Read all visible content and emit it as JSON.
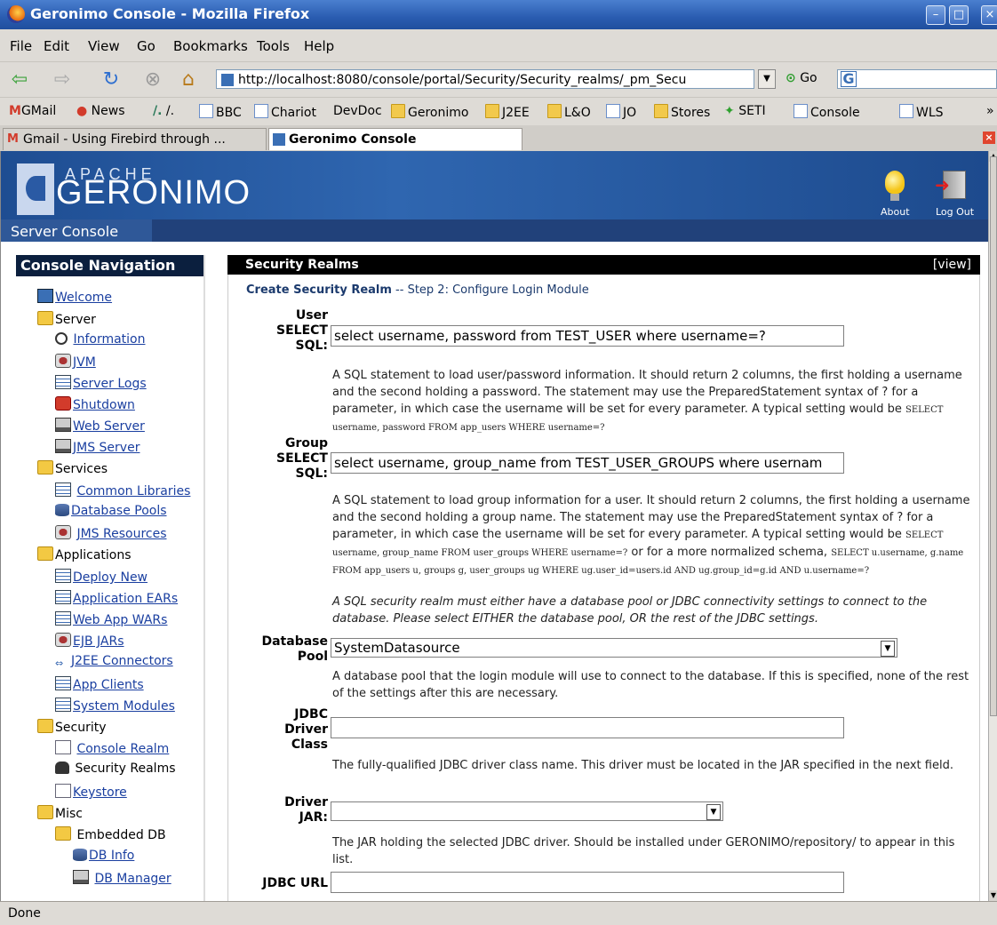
{
  "window": {
    "title": "Geronimo Console - Mozilla Firefox"
  },
  "menu": [
    "File",
    "Edit",
    "View",
    "Go",
    "Bookmarks",
    "Tools",
    "Help"
  ],
  "navbar": {
    "url": "http://localhost:8080/console/portal/Security/Security_realms/_pm_Secu",
    "go": "Go"
  },
  "bookmarks": [
    "GMail",
    "News",
    "/.",
    "BBC",
    "Chariot",
    "DevDoc",
    "Geronimo",
    "J2EE",
    "L&O",
    "JO",
    "Stores",
    "SETI",
    "Console",
    "WLS"
  ],
  "tabs": [
    "Gmail - Using Firebird through ...",
    "Geronimo Console"
  ],
  "header": {
    "apache": "APACHE",
    "geronimo": "GERONIMO",
    "server_console": "Server Console",
    "about": "About",
    "logout": "Log Out"
  },
  "nav": {
    "title": "Console Navigation",
    "welcome": "Welcome",
    "server": "Server",
    "information": "Information",
    "jvm": "JVM",
    "server_logs": "Server Logs",
    "shutdown": "Shutdown",
    "web_server": "Web Server",
    "jms_server": "JMS Server",
    "services": "Services",
    "common_libraries": "Common Libraries",
    "database_pools": "Database Pools",
    "jms_resources": "JMS Resources",
    "applications": "Applications",
    "deploy_new": "Deploy New",
    "application_ears": "Application EARs",
    "web_app_wars": "Web App WARs",
    "ejb_jars": "EJB JARs",
    "j2ee_connectors": "J2EE Connectors",
    "app_clients": "App Clients",
    "system_modules": "System Modules",
    "security": "Security",
    "console_realm": "Console Realm",
    "security_realms": "Security Realms",
    "keystore": "Keystore",
    "misc": "Misc",
    "embedded_db": "Embedded DB",
    "db_info": "DB Info",
    "db_manager": "DB Manager"
  },
  "main": {
    "title": "Security Realms",
    "view": "[view]",
    "step_bold": "Create Security Realm",
    "step_rest": " -- Step 2: Configure Login Module",
    "user_select": {
      "label1": "User",
      "label2": "SELECT",
      "label3": "SQL:",
      "value": "select username, password from TEST_USER where username=?",
      "desc": "A SQL statement to load user/password information. It should return 2 columns, the first holding a username and the second holding a password. The statement may use the PreparedStatement syntax of ? for a parameter, in which case the username will be set for every parameter. A typical setting would be ",
      "desc_code": "SELECT username, password FROM app_users WHERE username=?"
    },
    "group_select": {
      "label1": "Group",
      "label2": "SELECT",
      "label3": "SQL:",
      "value": "select username, group_name from TEST_USER_GROUPS where usernam",
      "desc": "A SQL statement to load group information for a user. It should return 2 columns, the first holding a username and the second holding a group name. The statement may use the PreparedStatement syntax of ? for a parameter, in which case the username will be set for every parameter. A typical setting would be ",
      "desc_code1": "SELECT username, group_name FROM user_groups WHERE username=?",
      "desc_mid": " or for a more normalized schema, ",
      "desc_code2": "SELECT u.username, g.name FROM app_users u, groups g, user_groups ug WHERE ug.user_id=users.id AND ug.group_id=g.id AND u.username=?"
    },
    "note": "A SQL security realm must either have a database pool or JDBC connectivity settings to connect to the database. Please select EITHER the database pool, OR the rest of the JDBC settings.",
    "db_pool": {
      "label1": "Database",
      "label2": "Pool",
      "value": "SystemDatasource",
      "desc": "A database pool that the login module will use to connect to the database. If this is specified, none of the rest of the settings after this are necessary."
    },
    "jdbc_driver": {
      "label1": "JDBC",
      "label2": "Driver",
      "label3": "Class",
      "value": "",
      "desc": "The fully-qualified JDBC driver class name. This driver must be located in the JAR specified in the next field."
    },
    "driver_jar": {
      "label1": "Driver",
      "label2": "JAR:",
      "value": "",
      "desc": "The JAR holding the selected JDBC driver. Should be installed under GERONIMO/repository/ to appear in this list."
    },
    "jdbc_url": {
      "label": "JDBC URL",
      "value": ""
    }
  },
  "status": "Done"
}
